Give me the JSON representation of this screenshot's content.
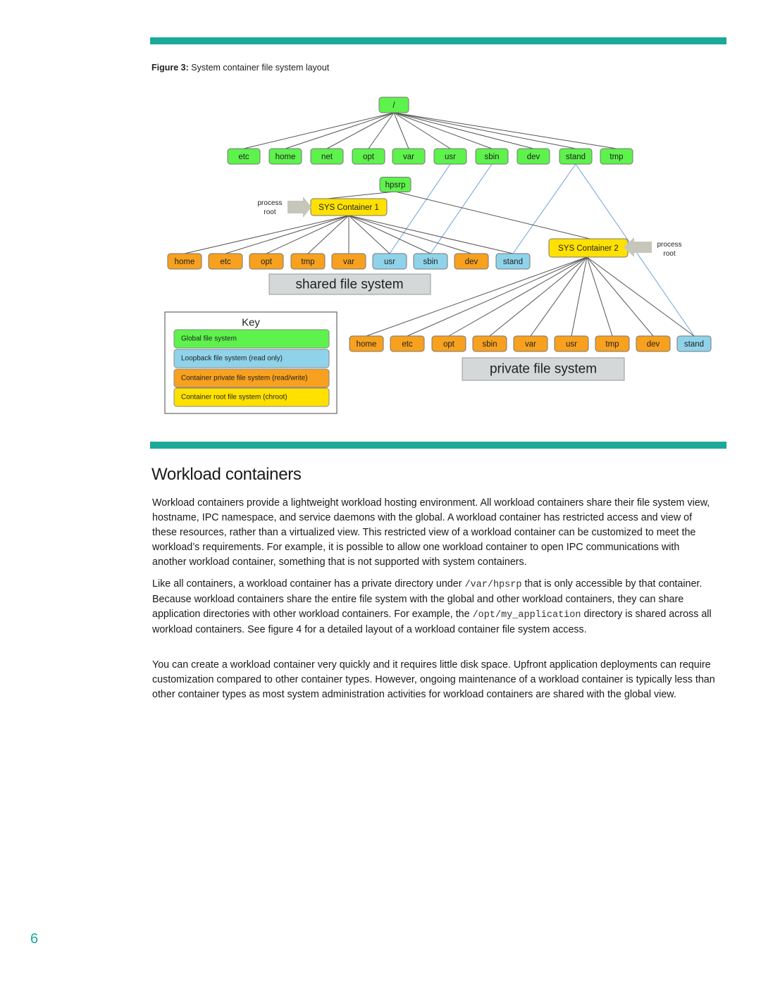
{
  "colors": {
    "accent": "#1ba99a",
    "global": "#5ef24d",
    "loopback": "#8fd3ea",
    "private": "#f7a11f",
    "root": "#ffe100",
    "label_box": "#d4d8d8",
    "arrow": "#c7c6bb",
    "line": "#555555",
    "link": "#6fa0e0"
  },
  "figure": {
    "caption_label": "Figure 3:",
    "caption_text": " System container file system layout",
    "root_node": "/",
    "top_level": [
      "etc",
      "home",
      "net",
      "opt",
      "var",
      "usr",
      "sbin",
      "dev",
      "stand",
      "tmp"
    ],
    "hpsrp": "hpsrp",
    "sys1": {
      "label": "SYS Container 1",
      "arrow_label_1": "process",
      "arrow_label_2": "root",
      "children": [
        {
          "label": "home",
          "type": "private"
        },
        {
          "label": "etc",
          "type": "private"
        },
        {
          "label": "opt",
          "type": "private"
        },
        {
          "label": "tmp",
          "type": "private"
        },
        {
          "label": "var",
          "type": "private"
        },
        {
          "label": "usr",
          "type": "loopback"
        },
        {
          "label": "sbin",
          "type": "loopback"
        },
        {
          "label": "dev",
          "type": "private"
        },
        {
          "label": "stand",
          "type": "loopback"
        }
      ],
      "section_label": "shared file system"
    },
    "sys2": {
      "label": "SYS Container 2",
      "arrow_label_1": "process",
      "arrow_label_2": "root",
      "children": [
        {
          "label": "home",
          "type": "private"
        },
        {
          "label": "etc",
          "type": "private"
        },
        {
          "label": "opt",
          "type": "private"
        },
        {
          "label": "sbin",
          "type": "private"
        },
        {
          "label": "var",
          "type": "private"
        },
        {
          "label": "usr",
          "type": "private"
        },
        {
          "label": "tmp",
          "type": "private"
        },
        {
          "label": "dev",
          "type": "private"
        },
        {
          "label": "stand",
          "type": "loopback"
        }
      ],
      "section_label": "private file system"
    },
    "key": {
      "title": "Key",
      "items": [
        {
          "label": "Global file system",
          "type": "global"
        },
        {
          "label": "Loopback file system  (read only)",
          "type": "loopback"
        },
        {
          "label": "Container  private file system (read/write)",
          "type": "private"
        },
        {
          "label": "Container root file system  (chroot)",
          "type": "root"
        }
      ]
    }
  },
  "section": {
    "heading": "Workload containers",
    "p1": "Workload containers provide a lightweight workload hosting environment. All workload containers share their file system view, hostname, IPC namespace, and service daemons with the global. A workload container has restricted access and view of these resources, rather than a virtualized view. This restricted view of a workload container can be customized to meet the workload’s requirements. For example, it is possible to allow one workload container to open IPC communications with another workload container, something that is not supported with system containers.",
    "p2_a": "Like all containers, a workload container has a private directory under ",
    "p2_code1": "/var/hpsrp",
    "p2_b": " that is only accessible by that container. Because workload containers share the entire file system with the global and other workload containers, they can share application directories with other workload containers. For example, the ",
    "p2_code2": "/opt/my_application",
    "p2_c": " directory is shared across all workload containers. See figure 4 for a detailed layout of a workload container file system access.",
    "p3": "You can create a workload container very quickly and it requires little disk space. Upfront application deployments can require customization compared to other container types. However, ongoing maintenance of a workload container is typically less than other container types as most system administration activities for workload containers are shared with the global view."
  },
  "page_number": "6"
}
